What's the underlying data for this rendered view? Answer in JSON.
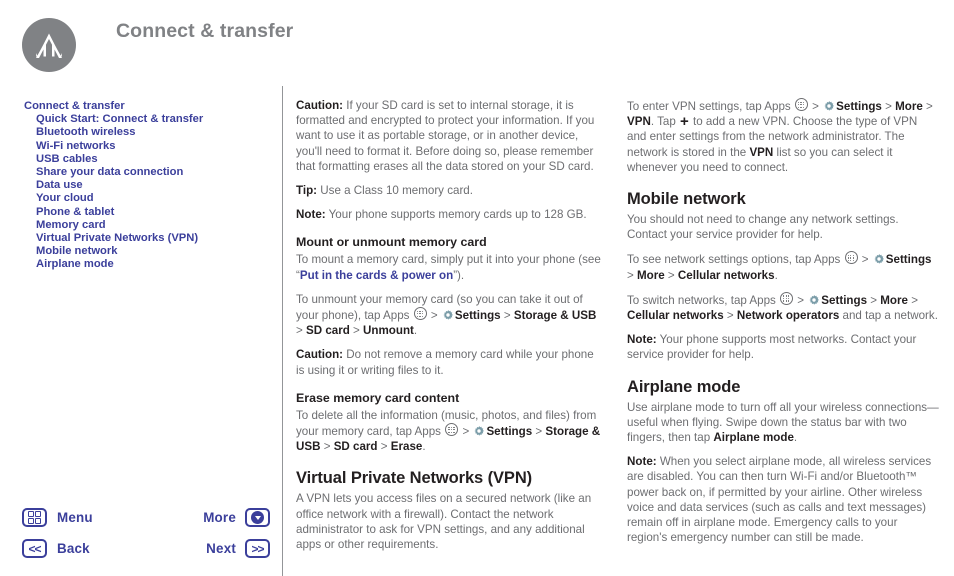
{
  "header": {
    "title": "Connect & transfer",
    "logo_name": "motorola-logo"
  },
  "colors": {
    "link": "#3b3f9b",
    "title_gray": "#808285",
    "body_gray": "#6d6e71",
    "heading_dark": "#231f20",
    "logo_gray": "#808285",
    "gear_icon": "#7a9ca8"
  },
  "sidebar": {
    "items": [
      {
        "label": "Connect & transfer",
        "level": 0
      },
      {
        "label": "Quick Start: Connect & transfer",
        "level": 1
      },
      {
        "label": "Bluetooth wireless",
        "level": 1
      },
      {
        "label": "Wi-Fi networks",
        "level": 1
      },
      {
        "label": "USB cables",
        "level": 1
      },
      {
        "label": "Share your data connection",
        "level": 1
      },
      {
        "label": "Data use",
        "level": 1
      },
      {
        "label": "Your cloud",
        "level": 1
      },
      {
        "label": "Phone & tablet",
        "level": 1
      },
      {
        "label": "Memory card",
        "level": 1
      },
      {
        "label": "Virtual Private Networks (VPN)",
        "level": 1
      },
      {
        "label": "Mobile network",
        "level": 1
      },
      {
        "label": "Airplane mode",
        "level": 1
      }
    ]
  },
  "middle_column": {
    "caution_sd_label": "Caution:",
    "caution_sd_text": " If your SD card is set to internal storage, it is formatted and encrypted to protect your information. If you want to use it as portable storage, or in another device, you'll need to format it. Before doing so, please remember that formatting erases all the data stored on your SD card.",
    "tip_label": "Tip:",
    "tip_text": " Use a Class 10 memory card.",
    "note_label": "Note:",
    "note_text": " Your phone supports memory cards up to 128 GB.",
    "mount_heading": "Mount or unmount memory card",
    "mount_text_a": "To mount a memory card, simply put it into your phone (see “",
    "mount_link": "Put in the cards & power on",
    "mount_text_b": "”).",
    "unmount_text_a": "To unmount your memory card (so you can take it out of your phone), tap Apps ",
    "unmount_gt1": " > ",
    "unmount_settings": "Settings",
    "unmount_gt2": " > ",
    "unmount_storage": "Storage & USB",
    "unmount_gt3": " > ",
    "unmount_sdcard": "SD card",
    "unmount_gt4": " > ",
    "unmount_action": "Unmount",
    "unmount_period": ".",
    "caution_remove_label": "Caution:",
    "caution_remove_text": " Do not remove a memory card while your phone is using it or writing files to it.",
    "erase_heading": "Erase memory card content",
    "erase_text_a": "To delete all the information (music, photos, and files) from your memory card, tap Apps ",
    "erase_gt1": " > ",
    "erase_settings": "Settings",
    "erase_gt2": " > ",
    "erase_storage": "Storage & USB",
    "erase_gt3": " > ",
    "erase_sdcard": "SD card",
    "erase_gt4": " > ",
    "erase_action": "Erase",
    "erase_period": ".",
    "vpn_heading": "Virtual Private Networks (VPN)",
    "vpn_text": "A VPN lets you access files on a secured network (like an office network with a firewall). Contact the network administrator to ask for VPN settings, and any additional apps or other requirements."
  },
  "right_column": {
    "vpn_enter_a": "To enter VPN settings, tap Apps ",
    "vpn_gt1": " > ",
    "vpn_settings": "Settings",
    "vpn_gt2": " > ",
    "vpn_more": "More",
    "vpn_gt3": " > ",
    "vpn_vpn": "VPN",
    "vpn_tap": ". Tap ",
    "vpn_plus": "+",
    "vpn_text_b": " to add a new VPN. Choose the type of VPN and enter settings from the network administrator. The network is stored in the ",
    "vpn_vpn2": "VPN",
    "vpn_text_c": " list so you can select it whenever you need to connect.",
    "mobile_heading": "Mobile network",
    "mobile_text": "You should not need to change any network settings. Contact your service provider for help.",
    "see_opts_a": "To see network settings options, tap Apps ",
    "see_opts_gt1": " > ",
    "see_opts_settings": "Settings",
    "see_opts_gt2": " > ",
    "see_opts_more": "More",
    "see_opts_gt3": " > ",
    "see_opts_cellular": "Cellular networks",
    "see_opts_period": ".",
    "switch_a": "To switch networks, tap Apps ",
    "switch_gt1": " > ",
    "switch_settings": "Settings",
    "switch_gt2": " > ",
    "switch_more": "More",
    "switch_gt3": " > ",
    "switch_cellular": "Cellular networks",
    "switch_gt4": " > ",
    "switch_operators": "Network operators",
    "switch_tail": " and tap a network.",
    "note_networks_label": "Note:",
    "note_networks_text": " Your phone supports most networks. Contact your service provider for help.",
    "airplane_heading": "Airplane mode",
    "airplane_text_a": "Use airplane mode to turn off all your wireless connections—useful when flying. Swipe down the status bar with two fingers, then tap ",
    "airplane_bold": "Airplane mode",
    "airplane_text_b": ".",
    "note_airplane_label": "Note:",
    "note_airplane_text": " When you select airplane mode, all wireless services are disabled. You can then turn Wi-Fi and/or Bluetooth™ power back on, if permitted by your airline. Other wireless voice and data services (such as calls and text messages) remain off in airplane mode. Emergency calls to your region's emergency number can still be made."
  },
  "navbar": {
    "menu_label": "Menu",
    "menu_icon": "grid-icon",
    "more_label": "More",
    "more_icon": "chevron-down-circle-icon",
    "back_label": "Back",
    "back_icon": "double-chevron-left-icon",
    "back_glyph": "<<",
    "next_label": "Next",
    "next_icon": "double-chevron-right-icon",
    "next_glyph": ">>"
  }
}
